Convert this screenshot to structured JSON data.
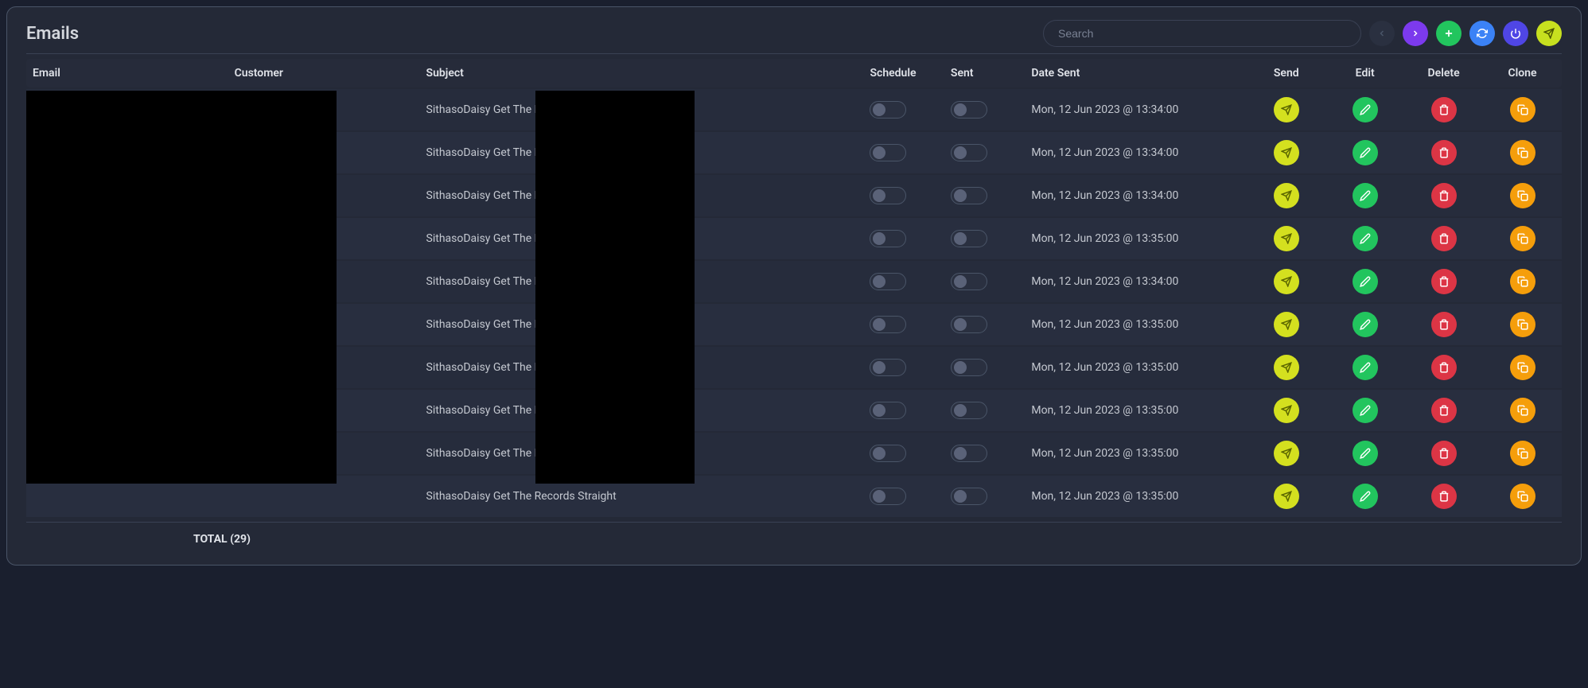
{
  "title": "Emails",
  "search_placeholder": "Search",
  "columns": {
    "email": "Email",
    "customer": "Customer",
    "subject": "Subject",
    "schedule": "Schedule",
    "sent": "Sent",
    "date_sent": "Date Sent",
    "send": "Send",
    "edit": "Edit",
    "delete": "Delete",
    "clone": "Clone"
  },
  "rows": [
    {
      "subject": "SithasoDaisy Get The Records Straight",
      "date_sent": "Mon, 12 Jun 2023 @ 13:34:00",
      "schedule": false,
      "sent": false
    },
    {
      "subject": "SithasoDaisy Get The Records Straight",
      "date_sent": "Mon, 12 Jun 2023 @ 13:34:00",
      "schedule": false,
      "sent": false
    },
    {
      "subject": "SithasoDaisy Get The Records Straight",
      "date_sent": "Mon, 12 Jun 2023 @ 13:34:00",
      "schedule": false,
      "sent": false
    },
    {
      "subject": "SithasoDaisy Get The Records Straight",
      "date_sent": "Mon, 12 Jun 2023 @ 13:35:00",
      "schedule": false,
      "sent": false
    },
    {
      "subject": "SithasoDaisy Get The Records Straight",
      "date_sent": "Mon, 12 Jun 2023 @ 13:34:00",
      "schedule": false,
      "sent": false
    },
    {
      "subject": "SithasoDaisy Get The Records Straight",
      "date_sent": "Mon, 12 Jun 2023 @ 13:35:00",
      "schedule": false,
      "sent": false
    },
    {
      "subject": "SithasoDaisy Get The Records Straight",
      "date_sent": "Mon, 12 Jun 2023 @ 13:35:00",
      "schedule": false,
      "sent": false
    },
    {
      "subject": "SithasoDaisy Get The Records Straight",
      "date_sent": "Mon, 12 Jun 2023 @ 13:35:00",
      "schedule": false,
      "sent": false
    },
    {
      "subject": "SithasoDaisy Get The Records Straight",
      "date_sent": "Mon, 12 Jun 2023 @ 13:35:00",
      "schedule": false,
      "sent": false
    },
    {
      "subject": "SithasoDaisy Get The Records Straight",
      "date_sent": "Mon, 12 Jun 2023 @ 13:35:00",
      "schedule": false,
      "sent": false
    }
  ],
  "footer_total": "TOTAL (29)"
}
